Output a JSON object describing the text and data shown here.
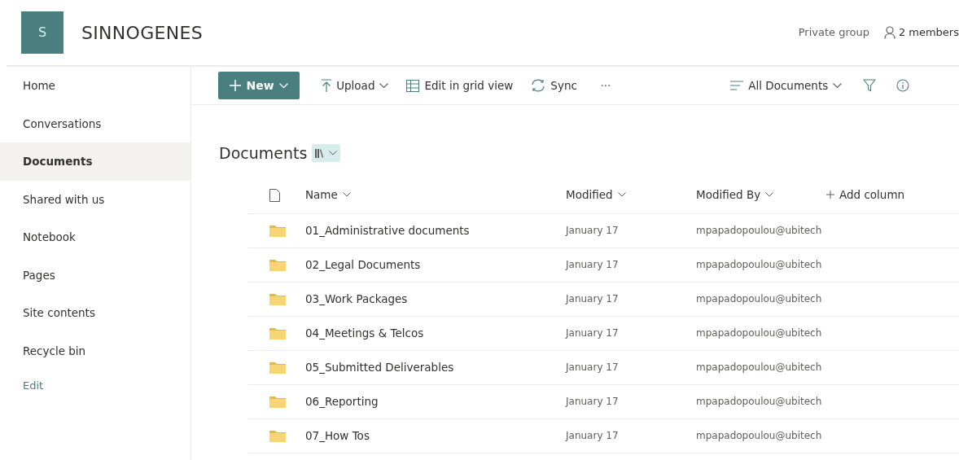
{
  "site": {
    "logo_letter": "S",
    "title": "SINNOGENES",
    "privacy": "Private group",
    "members": "2 members"
  },
  "sidebar": {
    "items": [
      {
        "label": "Home",
        "selected": false
      },
      {
        "label": "Conversations",
        "selected": false
      },
      {
        "label": "Documents",
        "selected": true
      },
      {
        "label": "Shared with us",
        "selected": false
      },
      {
        "label": "Notebook",
        "selected": false
      },
      {
        "label": "Pages",
        "selected": false
      },
      {
        "label": "Site contents",
        "selected": false
      },
      {
        "label": "Recycle bin",
        "selected": false
      }
    ],
    "edit_link": "Edit"
  },
  "command_bar": {
    "new_button": "New",
    "upload": "Upload",
    "grid_view": "Edit in grid view",
    "sync": "Sync",
    "more": "···",
    "view": "All Documents"
  },
  "library": {
    "title": "Documents",
    "columns": [
      "Name",
      "Modified",
      "Modified By",
      "Add column"
    ],
    "rows": [
      {
        "name": "01_Administrative documents",
        "modified": "January 17",
        "modified_by": "mpapadopoulou@ubitech"
      },
      {
        "name": "02_Legal Documents",
        "modified": "January 17",
        "modified_by": "mpapadopoulou@ubitech"
      },
      {
        "name": "03_Work Packages",
        "modified": "January 17",
        "modified_by": "mpapadopoulou@ubitech"
      },
      {
        "name": "04_Meetings & Telcos",
        "modified": "January 17",
        "modified_by": "mpapadopoulou@ubitech"
      },
      {
        "name": "05_Submitted Deliverables",
        "modified": "January 17",
        "modified_by": "mpapadopoulou@ubitech"
      },
      {
        "name": "06_Reporting",
        "modified": "January 17",
        "modified_by": "mpapadopoulou@ubitech"
      },
      {
        "name": "07_How Tos",
        "modified": "January 17",
        "modified_by": "mpapadopoulou@ubitech"
      }
    ]
  }
}
